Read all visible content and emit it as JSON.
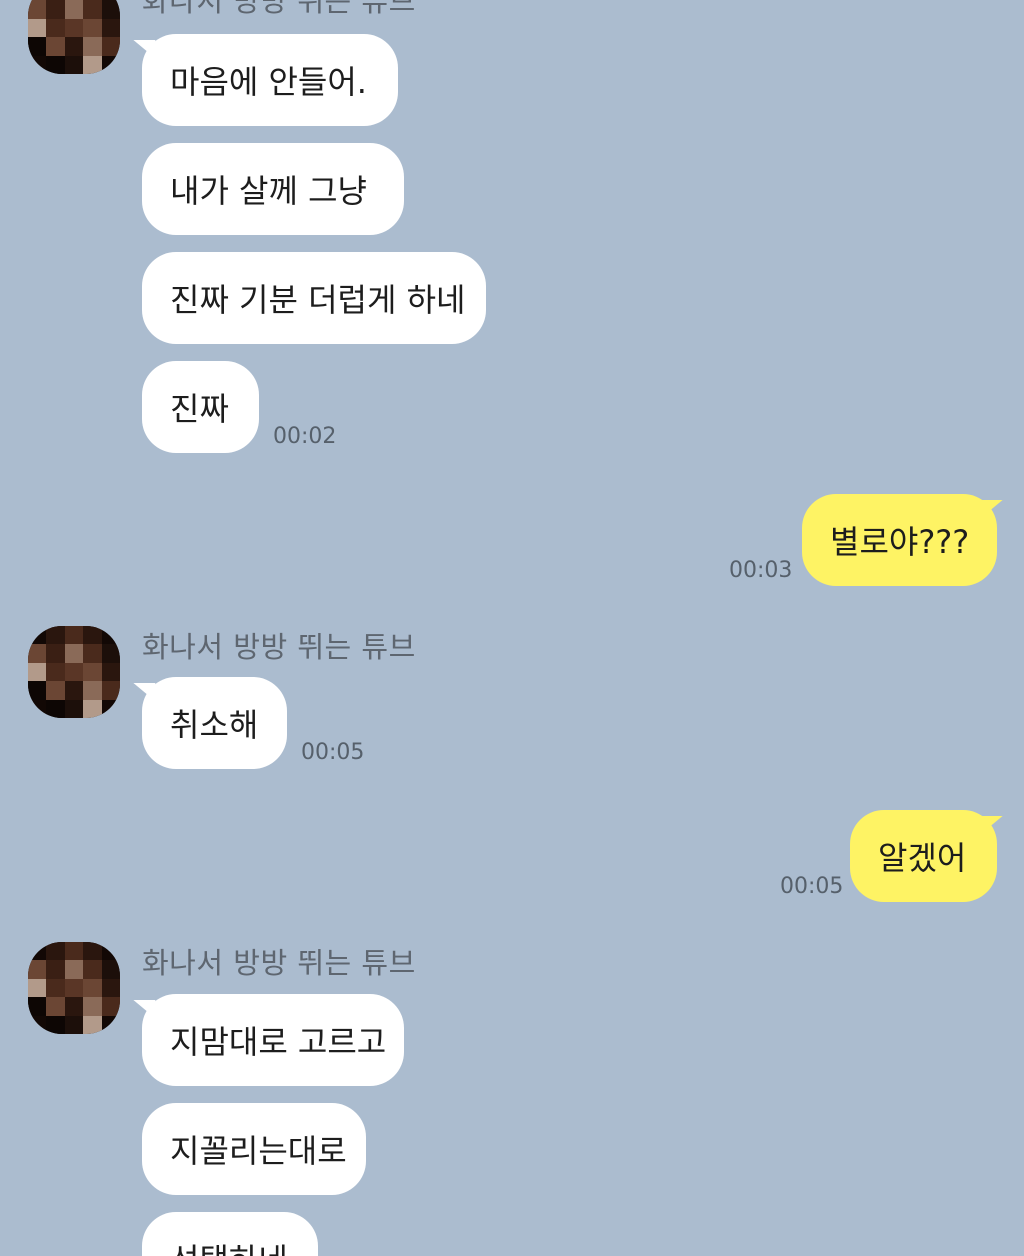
{
  "chat": {
    "sender_name": "화나서 방방 뛰는 튜브",
    "colors": {
      "background": "#abbccf",
      "incoming_bubble": "#ffffff",
      "outgoing_bubble": "#fef364",
      "name_text": "#5e6670",
      "time_text": "#56606b"
    },
    "avatar_icon": "pixelated-profile-icon",
    "groups": [
      {
        "sender_name": "화나서 방방 뛰는 튜브",
        "messages": [
          "마음에 안들어.",
          "내가 살께 그냥",
          "진짜 기분 더럽게 하네",
          "진짜"
        ],
        "time": "00:02"
      },
      {
        "outgoing": true,
        "messages": [
          "별로야???"
        ],
        "time": "00:03"
      },
      {
        "sender_name": "화나서 방방 뛰는 튜브",
        "messages": [
          "취소해"
        ],
        "time": "00:05"
      },
      {
        "outgoing": true,
        "messages": [
          "알겠어"
        ],
        "time": "00:05"
      },
      {
        "sender_name": "화나서 방방 뛰는 튜브",
        "messages": [
          "지맘대로 고르고",
          "지꼴리는대로",
          "선택하네"
        ]
      }
    ]
  }
}
